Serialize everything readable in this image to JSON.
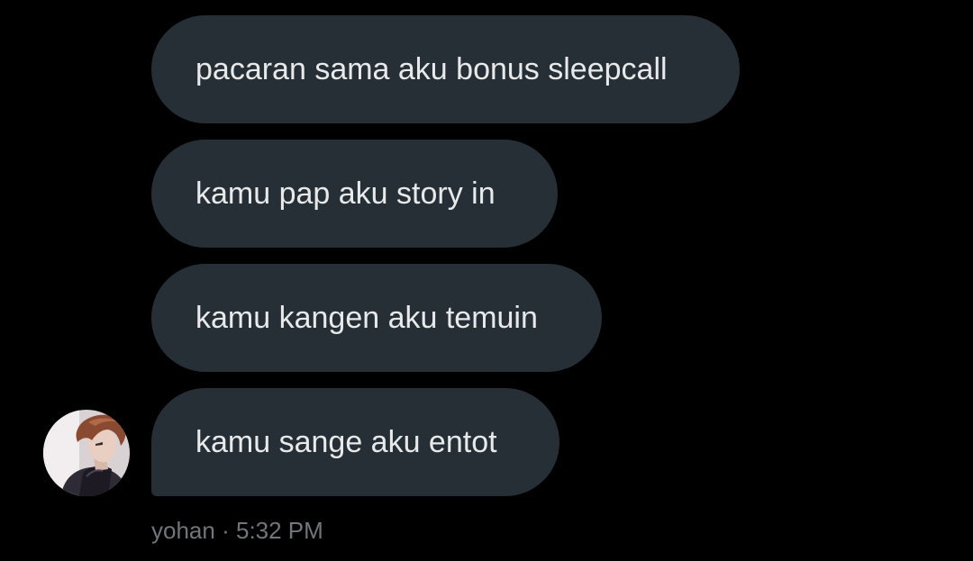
{
  "conversation": {
    "messages": [
      {
        "text": "pacaran sama aku bonus sleepcall"
      },
      {
        "text": "kamu pap aku story in"
      },
      {
        "text": "kamu kangen aku temuin"
      },
      {
        "text": "kamu sange aku entot"
      }
    ],
    "sender": {
      "name": "yohan",
      "separator": "·",
      "time": "5:32 PM",
      "avatar_icon": "user-avatar-illustration"
    }
  },
  "colors": {
    "background": "#000000",
    "bubble": "#262f36",
    "bubble_text": "#e7e9ea",
    "meta_text": "#71767b"
  }
}
